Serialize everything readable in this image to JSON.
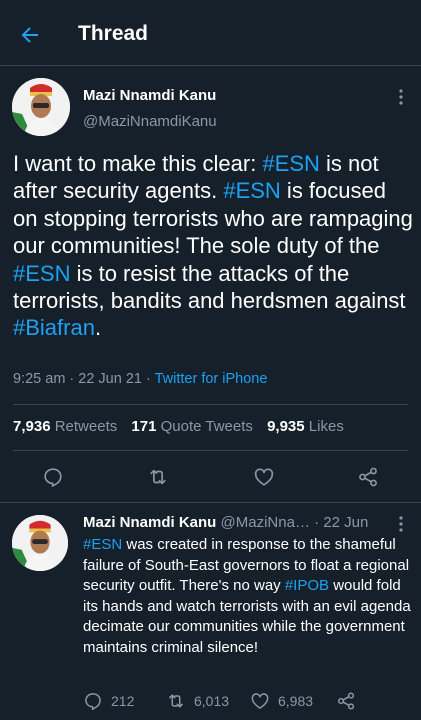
{
  "header": {
    "title": "Thread"
  },
  "main_tweet": {
    "display_name": "Mazi Nnamdi Kanu",
    "handle": "@MaziNnamdiKanu",
    "text_segments": [
      {
        "t": "I want to make this clear: "
      },
      {
        "t": "#ESN",
        "tag": true
      },
      {
        "t": " is not after security agents. "
      },
      {
        "t": "#ESN",
        "tag": true
      },
      {
        "t": " is focused on stopping terrorists who are rampaging our communities! The sole duty of the "
      },
      {
        "t": "#ESN",
        "tag": true
      },
      {
        "t": " is to resist the attacks of the terrorists, bandits and herdsmen against "
      },
      {
        "t": "#Biafran",
        "tag": true
      },
      {
        "t": "."
      }
    ],
    "time": "9:25 am · 22 Jun 21 · ",
    "source": "Twitter for iPhone",
    "retweets": "7,936",
    "retweets_label": "Retweets",
    "quotes": "171",
    "quotes_label": "Quote Tweets",
    "likes": "9,935",
    "likes_label": "Likes"
  },
  "reply_tweet": {
    "display_name": "Mazi Nnamdi Kanu",
    "handle_date": "@MaziNna… · 22 Jun",
    "text_segments": [
      {
        "t": "#ESN",
        "tag": true
      },
      {
        "t": " was created in response to the shameful failure of South-East governors to float a regional security outfit. There's no way "
      },
      {
        "t": "#IPOB",
        "tag": true
      },
      {
        "t": " would fold its hands and watch terrorists with an evil agenda decimate our communities while the government maintains criminal silence!"
      }
    ],
    "replies": "212",
    "retweets": "6,013",
    "likes": "6,983"
  },
  "colors": {
    "background": "#15202b",
    "accent": "#1da1f2",
    "muted": "#8899a6",
    "divider": "#38444d"
  },
  "icons": [
    "back-arrow-icon",
    "more-icon",
    "reply-icon",
    "retweet-icon",
    "like-icon",
    "share-icon"
  ]
}
